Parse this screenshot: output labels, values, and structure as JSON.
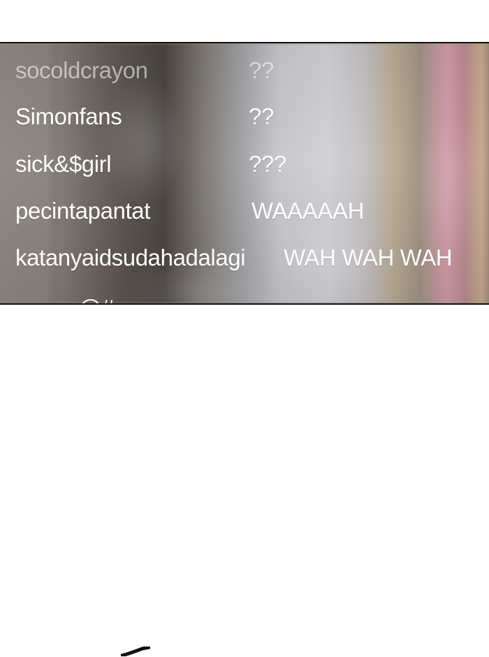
{
  "chat": {
    "entries": [
      {
        "username": "socoldcrayon",
        "message": "??"
      },
      {
        "username": "Simonfans",
        "message": "??"
      },
      {
        "username": "sick&$girl",
        "message": "???"
      },
      {
        "username": "pecintapantat",
        "message": "WAAAAAH"
      },
      {
        "username": "katanyaidsudahadalagi",
        "message": "WAH WAH WAH"
      },
      {
        "username": "aagaa@#gr",
        "message": ""
      }
    ]
  },
  "colors": {
    "text": "#ffffff",
    "border": "#111111",
    "background": "#ffffff"
  },
  "icons": {
    "bottom_mark": "brush-stroke-icon"
  }
}
